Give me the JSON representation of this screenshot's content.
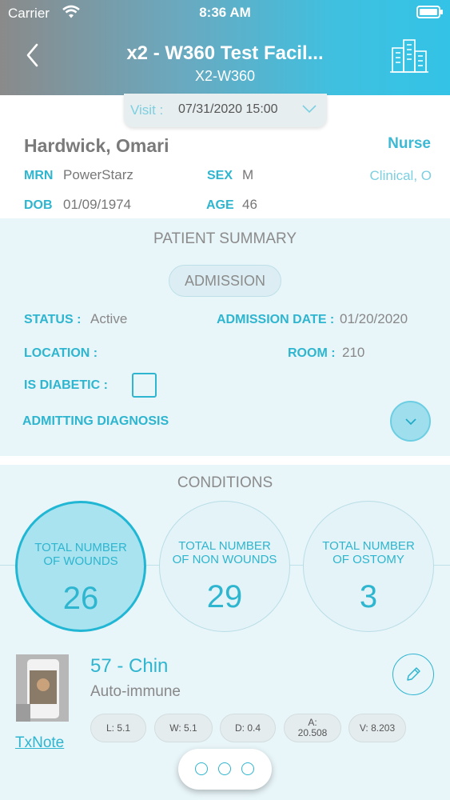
{
  "status_bar": {
    "carrier": "Carrier",
    "time": "8:36 AM"
  },
  "header": {
    "title": "x2 - W360 Test Facil...",
    "subtitle": "X2-W360"
  },
  "visit": {
    "label": "Visit :",
    "value": "07/31/2020 15:00"
  },
  "patient": {
    "name": "Hardwick, Omari",
    "role": "Nurse",
    "mrn_label": "MRN",
    "mrn": "PowerStarz",
    "sex_label": "SEX",
    "sex": "M",
    "clinical": "Clinical, O",
    "dob_label": "DOB",
    "dob": "01/09/1974",
    "age_label": "AGE",
    "age": "46"
  },
  "summary": {
    "title": "PATIENT SUMMARY",
    "admission_pill": "ADMISSION",
    "status_label": "STATUS :",
    "status": "Active",
    "admission_date_label": "ADMISSION DATE :",
    "admission_date": "01/20/2020",
    "location_label": "LOCATION :",
    "room_label": "ROOM :",
    "room": "210",
    "diabetic_label": "IS DIABETIC :",
    "diagnosis_label": "ADMITTING DIAGNOSIS"
  },
  "conditions": {
    "title": "CONDITIONS",
    "circles": [
      {
        "label": "TOTAL NUMBER OF WOUNDS",
        "value": "26"
      },
      {
        "label": "TOTAL NUMBER OF NON WOUNDS",
        "value": "29"
      },
      {
        "label": "TOTAL NUMBER OF OSTOMY",
        "value": "3"
      }
    ]
  },
  "wound": {
    "title": "57 - Chin",
    "type": "Auto-immune",
    "link": "TxNote",
    "measurements": [
      {
        "line1": "L: 5.1",
        "line2": ""
      },
      {
        "line1": "W: 5.1",
        "line2": ""
      },
      {
        "line1": "D: 0.4",
        "line2": ""
      },
      {
        "line1": "A:",
        "line2": "20.508"
      },
      {
        "line1": "V: 8.203",
        "line2": ""
      }
    ]
  },
  "colors": {
    "accent": "#2eb5cf",
    "header_start": "#8a8a8a",
    "header_end": "#33c3e6",
    "panel_bg": "#e8f5f9"
  }
}
